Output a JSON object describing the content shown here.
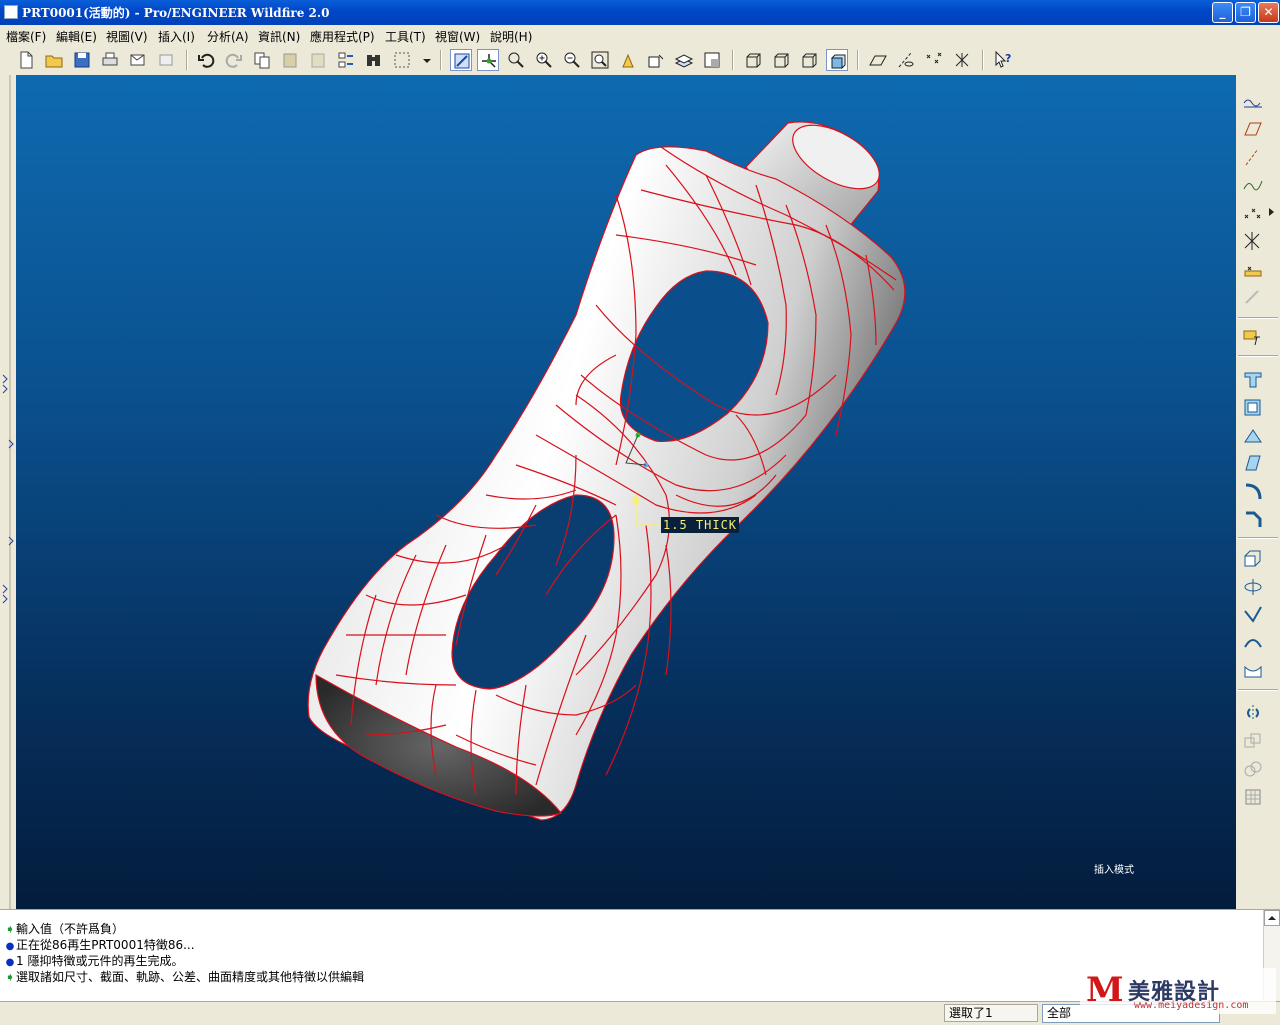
{
  "window": {
    "title": "PRT0001(活動的) - Pro/ENGINEER Wildfire 2.0",
    "minimize": "_",
    "restore": "❐",
    "close": "✕"
  },
  "menu": [
    "檔案(F)",
    "編輯(E)",
    "視圖(V)",
    "插入(I)",
    "分析(A)",
    "資訊(N)",
    "應用程式(P)",
    "工具(T)",
    "視窗(W)",
    "說明(H)"
  ],
  "viewport": {
    "dimension_label": "1.5 THICK",
    "mode_text": "插入模式"
  },
  "messages": [
    {
      "kind": "prompt",
      "text": "輸入值（不許爲負）"
    },
    {
      "kind": "info",
      "text": "正在從86再生PRT0001特徵86..."
    },
    {
      "kind": "info",
      "text": "1 隱抑特徵或元件的再生完成。"
    },
    {
      "kind": "prompt",
      "text": "選取諸如尺寸、截面、軌跡、公差、曲面精度或其他特徵以供編輯"
    }
  ],
  "status": {
    "selected": "選取了1",
    "filter": "全部"
  },
  "watermark": {
    "mark": "M",
    "name": "美雅設計",
    "url": "www.meiyadesign.com"
  },
  "colors": {
    "model_edges": "#d8101a",
    "viewport_top": "#0e6ab0",
    "viewport_bottom": "#041c3c"
  }
}
